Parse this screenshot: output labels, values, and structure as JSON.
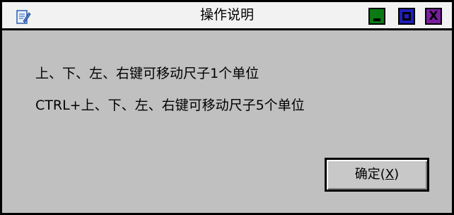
{
  "window": {
    "title": "操作说明",
    "app_icon": "notepad-edit-icon",
    "controls": {
      "minimize_icon": "minimize-icon",
      "maximize_icon": "maximize-icon",
      "close_icon": "close-icon",
      "close_glyph": "X",
      "colors": {
        "minimize": "#0a7a14",
        "maximize": "#1f1fb8",
        "close": "#7a1ea0"
      }
    }
  },
  "dialog": {
    "lines": [
      "上、下、左、右键可移动尺子1个单位",
      "CTRL+上、下、左、右键可移动尺子5个单位"
    ],
    "ok_button": {
      "label_prefix": "确定(",
      "mnemonic": "X",
      "label_suffix": ")"
    }
  }
}
